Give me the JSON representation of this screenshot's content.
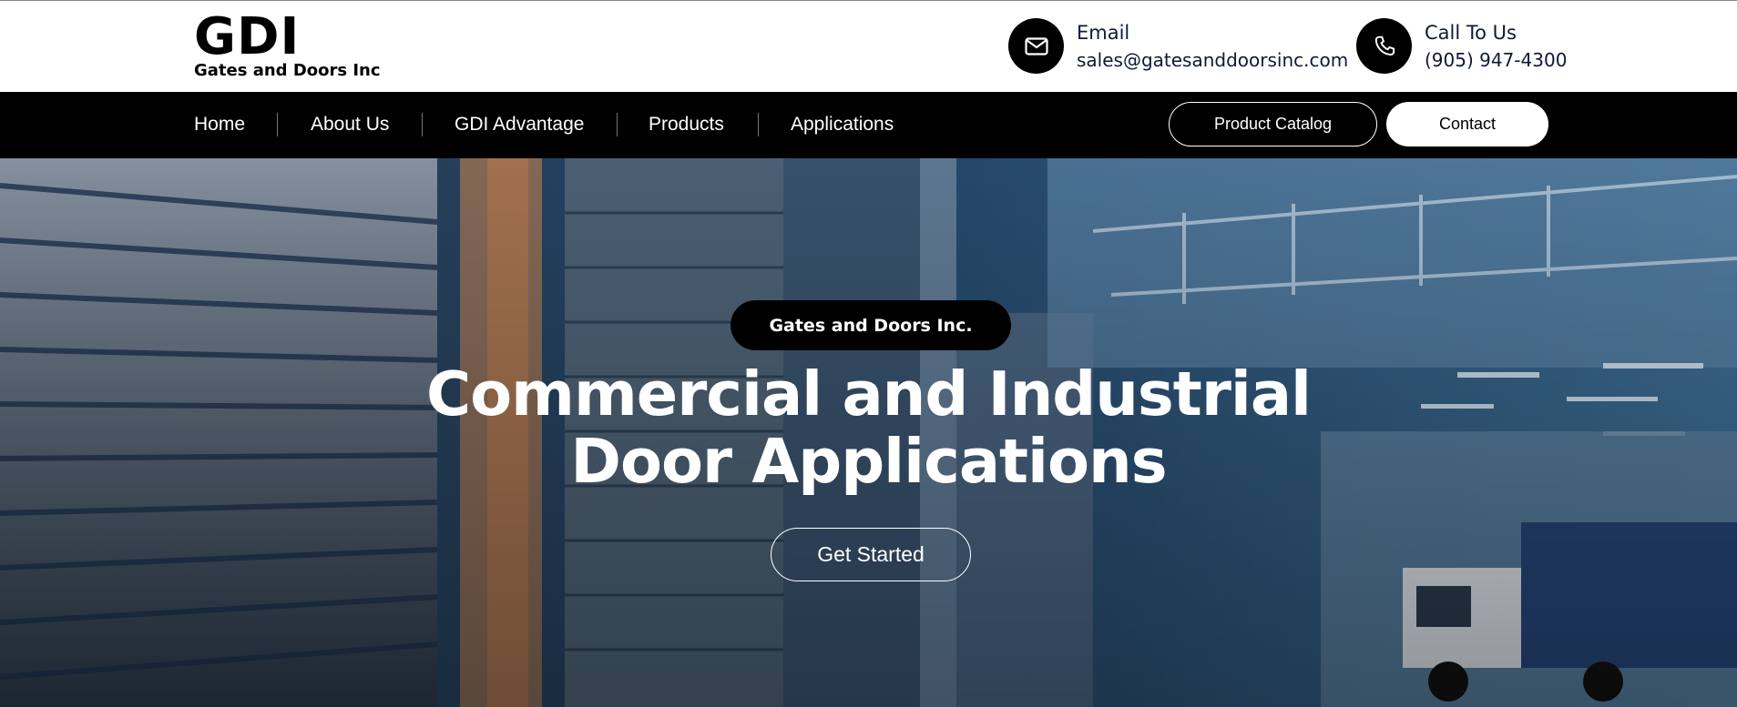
{
  "logo": {
    "main": "GDI",
    "sub": "Gates and Doors Inc"
  },
  "contact": {
    "email": {
      "icon": "mail-icon",
      "title": "Email",
      "value": "sales@gatesanddoorsinc.com"
    },
    "phone": {
      "icon": "phone-icon",
      "title": "Call To Us",
      "value": "(905) 947-4300"
    }
  },
  "nav": {
    "items": [
      {
        "label": "Home"
      },
      {
        "label": "About Us"
      },
      {
        "label": "GDI Advantage"
      },
      {
        "label": "Products"
      },
      {
        "label": "Applications"
      }
    ],
    "catalog_label": "Product Catalog",
    "contact_label": "Contact"
  },
  "hero": {
    "badge": "Gates and Doors Inc.",
    "title_line1": "Commercial and Industrial",
    "title_line2": "Door Applications",
    "cta_label": "Get Started"
  },
  "colors": {
    "nav_bg": "#000000",
    "hero_tint": "#1f3a56",
    "accent_text": "#0f1a33"
  }
}
